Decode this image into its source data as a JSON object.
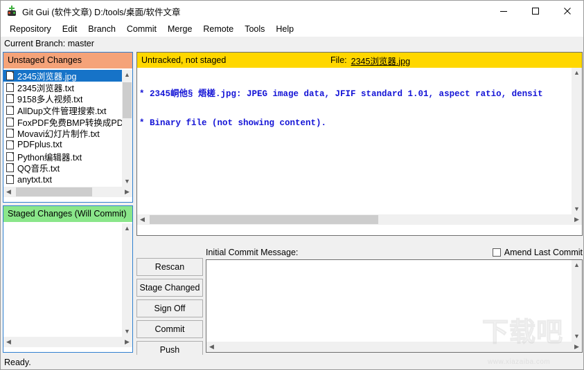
{
  "window": {
    "title": "Git Gui (软件文章) D:/tools/桌面/软件文章",
    "icon": "git-gui-icon",
    "controls": {
      "minimize": "minimize-icon",
      "maximize": "maximize-icon",
      "close": "close-icon"
    }
  },
  "menubar": {
    "items": [
      {
        "label": "Repository"
      },
      {
        "label": "Edit"
      },
      {
        "label": "Branch"
      },
      {
        "label": "Commit"
      },
      {
        "label": "Merge"
      },
      {
        "label": "Remote"
      },
      {
        "label": "Tools"
      },
      {
        "label": "Help"
      }
    ]
  },
  "branchbar": {
    "text": "Current Branch: master"
  },
  "unstaged": {
    "header": "Unstaged Changes",
    "header_color": "#f5a379",
    "files": [
      {
        "name": "2345浏览器.jpg",
        "selected": true
      },
      {
        "name": "2345浏览器.txt",
        "selected": false
      },
      {
        "name": "9158多人视频.txt",
        "selected": false
      },
      {
        "name": "AllDup文件管理搜索.txt",
        "selected": false
      },
      {
        "name": "FoxPDF免费BMP转换成PDF",
        "selected": false
      },
      {
        "name": "Movavi幻灯片制作.txt",
        "selected": false
      },
      {
        "name": "PDFplus.txt",
        "selected": false
      },
      {
        "name": "Python编辑器.txt",
        "selected": false
      },
      {
        "name": "QQ音乐.txt",
        "selected": false
      },
      {
        "name": "anytxt.txt",
        "selected": false
      }
    ]
  },
  "staged": {
    "header": "Staged Changes (Will Commit)",
    "header_color": "#8ae68a",
    "files": []
  },
  "diff": {
    "status": "Untracked, not staged",
    "file_label": "File:",
    "file_name": "2345浏览器.jpg",
    "header_color": "#ffd700",
    "text_color": "#1414d6",
    "lines": [
      "* 2345峒他§ 焐槎.jpg: JPEG image data, JFIF standard 1.01, aspect ratio, densit",
      "* Binary file (not showing content)."
    ]
  },
  "buttons": [
    {
      "label": "Rescan"
    },
    {
      "label": "Stage Changed"
    },
    {
      "label": "Sign Off"
    },
    {
      "label": "Commit"
    },
    {
      "label": "Push"
    }
  ],
  "commit": {
    "label": "Initial Commit Message:",
    "amend_label": "Amend Last Commit",
    "amend_checked": false,
    "message": ""
  },
  "statusbar": {
    "text": "Ready."
  },
  "watermark": {
    "big": "下载吧",
    "small": "www.xiazaiba.com"
  }
}
